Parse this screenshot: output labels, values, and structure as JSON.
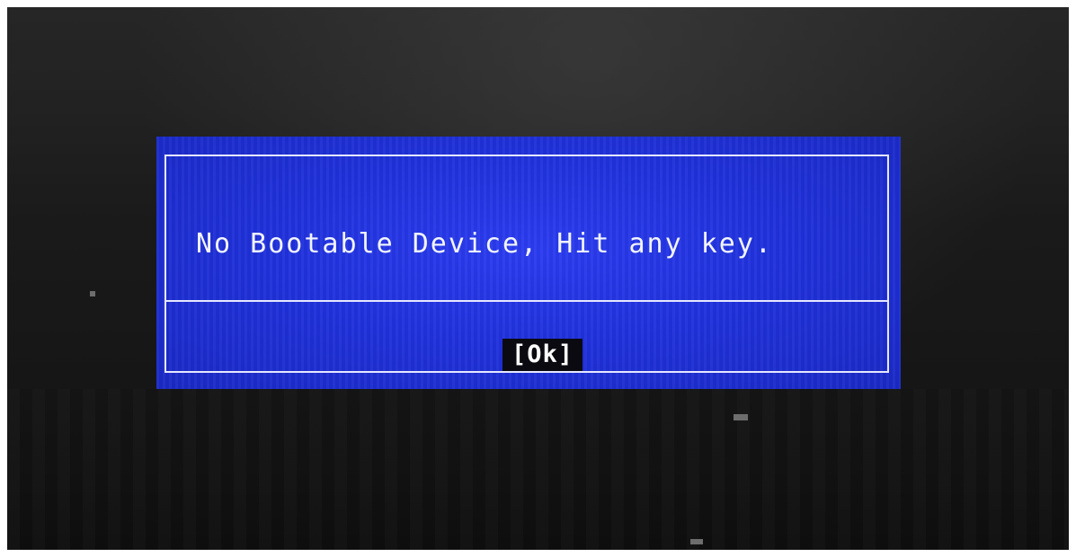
{
  "dialog": {
    "message": "No Bootable Device, Hit any key.",
    "ok_label": "[Ok]"
  },
  "colors": {
    "dialog_background": "#2032dd",
    "border": "#e6e8ff",
    "text": "#f2f4ff",
    "button_background": "#0a0a10",
    "surround": "#1a1a1a"
  }
}
